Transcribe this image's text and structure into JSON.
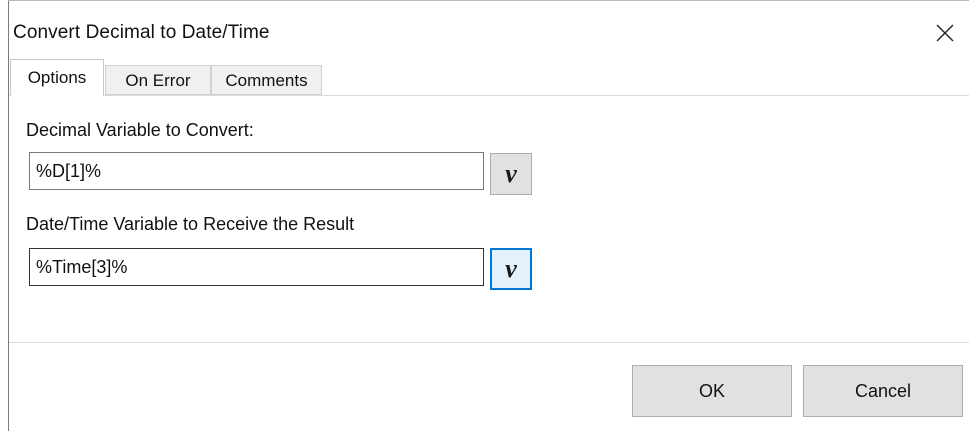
{
  "window": {
    "title": "Convert Decimal to Date/Time",
    "close_icon": "close-icon"
  },
  "tabs": [
    {
      "label": "Options",
      "active": true
    },
    {
      "label": "On Error",
      "active": false
    },
    {
      "label": "Comments",
      "active": false
    }
  ],
  "options": {
    "decimal_variable": {
      "label": "Decimal Variable to Convert:",
      "value": "%D[1]%",
      "variable_button_label": "v"
    },
    "datetime_variable": {
      "label": "Date/Time Variable to Receive the Result",
      "value": "%Time[3]%",
      "variable_button_label": "v"
    }
  },
  "footer": {
    "ok_label": "OK",
    "cancel_label": "Cancel"
  },
  "colors": {
    "focus_accent": "#0078d7",
    "button_face": "#e1e1e1"
  }
}
